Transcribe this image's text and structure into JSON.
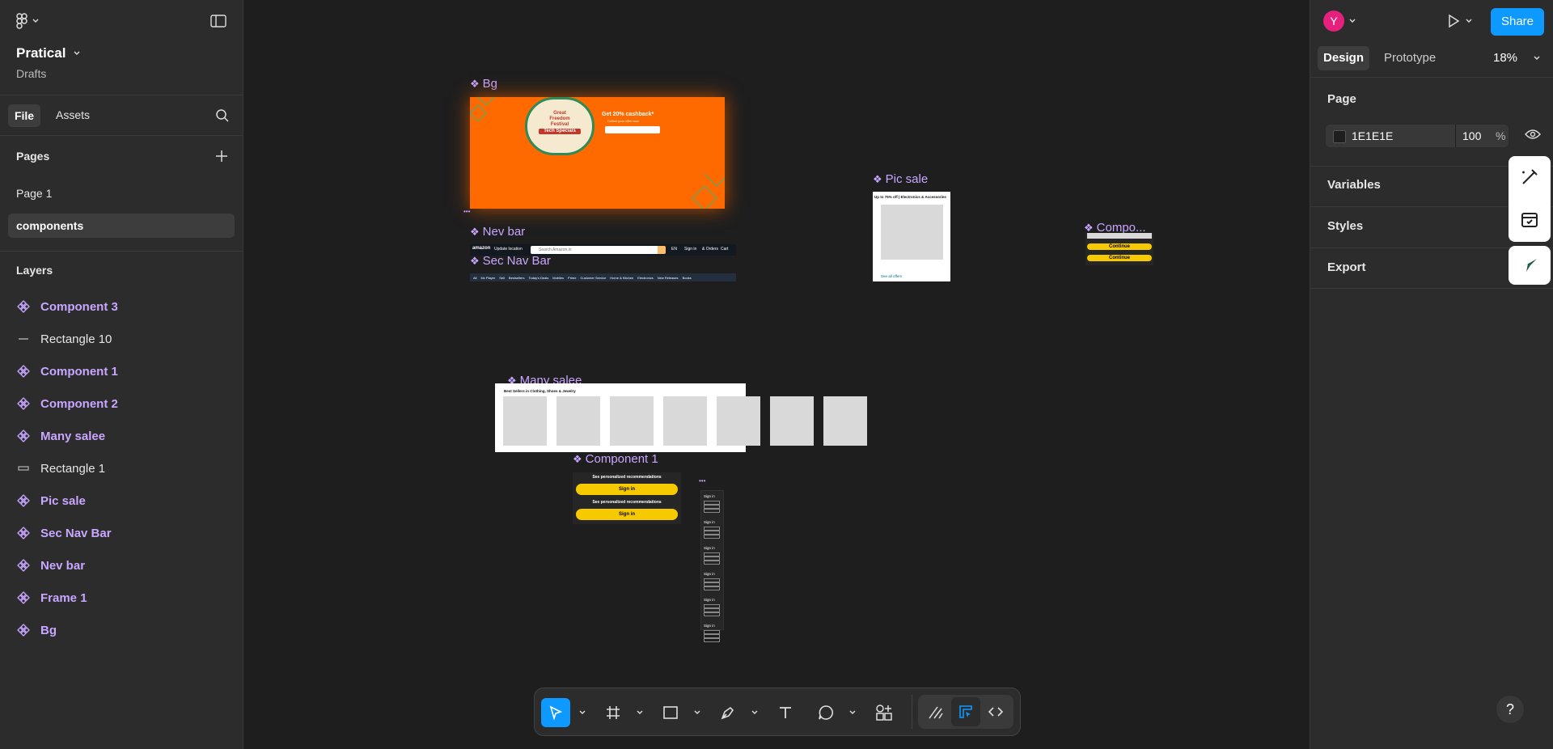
{
  "app": {
    "project_name": "Pratical",
    "project_location": "Drafts",
    "user_initial": "Y",
    "share_label": "Share",
    "zoom": "18%",
    "accent": "#0d99ff"
  },
  "left_panel": {
    "tabs": [
      "File",
      "Assets"
    ],
    "pages_heading": "Pages",
    "pages": [
      "Page 1",
      "components"
    ],
    "selected_page": "components",
    "layers_heading": "Layers",
    "layers": [
      {
        "label": "Component 3",
        "kind": "component"
      },
      {
        "label": "Rectangle 10",
        "kind": "line"
      },
      {
        "label": "Component 1",
        "kind": "component"
      },
      {
        "label": "Component 2",
        "kind": "component"
      },
      {
        "label": "Many salee",
        "kind": "component"
      },
      {
        "label": "Rectangle 1",
        "kind": "rect"
      },
      {
        "label": "Pic sale",
        "kind": "component"
      },
      {
        "label": "Sec Nav Bar",
        "kind": "component"
      },
      {
        "label": "Nev bar",
        "kind": "component"
      },
      {
        "label": "Frame 1",
        "kind": "component"
      },
      {
        "label": "Bg",
        "kind": "component"
      }
    ]
  },
  "right_panel": {
    "tabs": [
      "Design",
      "Prototype"
    ],
    "page_heading": "Page",
    "bg_color": "1E1E1E",
    "bg_opacity": "100",
    "percent": "%",
    "sections": [
      "Variables",
      "Styles",
      "Export"
    ]
  },
  "canvas": {
    "frames": {
      "bg": "Bg",
      "nav": "Nev bar",
      "sec_nav": "Sec Nav Bar",
      "pic_sale": "Pic sale",
      "compo": "Compo...",
      "many": "Many salee",
      "comp1": "Component 1"
    },
    "banner": {
      "badge_line1": "Great",
      "badge_line2": "Freedom",
      "badge_line3": "Festival",
      "badge_line4": "Tech Specials",
      "cashback": "Get 20% cashback*",
      "cashback_sub": "Collect your offer now"
    },
    "nav": {
      "logo": "amazon",
      "location": "Update location",
      "search_placeholder": "Search Amazon.in",
      "lang": "EN",
      "signin": "Sign in",
      "orders": "& Orders",
      "cart": "Cart"
    },
    "sec_nav_items": [
      "All",
      "Mx Player",
      "Sell",
      "Bestsellers",
      "Today's Deals",
      "Mobiles",
      "Prime",
      "Customer Service",
      "Home & Kitchen",
      "Electronics",
      "New Releases",
      "Books"
    ],
    "pic_sale": {
      "title": "Up to 75% off | Electronics & Accessories",
      "link": "See all offers"
    },
    "many_title": "Best Sellers in Clothing, Shoes & Jewelry",
    "comp1": {
      "text1": "See personalized recommendations",
      "btn1": "Sign in",
      "text2": "See personalized recommendations",
      "btn2": "Sign in"
    },
    "compo_buttons": [
      "Continue",
      "Continue"
    ],
    "stack_items": [
      "Sign in",
      "Sign in",
      "Sign in",
      "Sign in",
      "Sign in",
      "Sign in"
    ]
  },
  "help": "?"
}
